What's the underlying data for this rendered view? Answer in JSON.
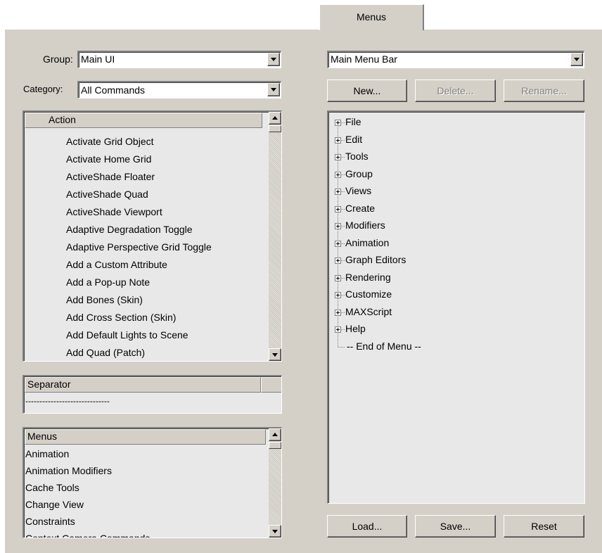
{
  "tab": {
    "label": "Menus"
  },
  "left": {
    "group": {
      "label": "Group:",
      "value": "Main UI"
    },
    "category": {
      "label": "Category:",
      "value": "All Commands"
    },
    "action_list": {
      "header": "Action",
      "items": [
        "Activate Grid Object",
        "Activate Home Grid",
        "ActiveShade Floater",
        "ActiveShade Quad",
        "ActiveShade Viewport",
        "Adaptive Degradation Toggle",
        "Adaptive Perspective Grid Toggle",
        "Add a Custom Attribute",
        "Add a Pop-up Note",
        "Add Bones (Skin)",
        "Add Cross Section (Skin)",
        "Add Default Lights to Scene",
        "Add Quad (Patch)"
      ]
    },
    "separator_list": {
      "header": "Separator",
      "items": [
        "------------------------------"
      ]
    },
    "menus_list": {
      "header": "Menus",
      "items": [
        "Animation",
        "Animation Modifiers",
        "Cache Tools",
        "Change View",
        "Constraints",
        "Context Camera Commands"
      ]
    }
  },
  "right": {
    "menu_select": {
      "value": "Main Menu Bar"
    },
    "buttons": {
      "new": "New...",
      "delete": "Delete...",
      "rename": "Rename..."
    },
    "tree": {
      "items": [
        "File",
        "Edit",
        "Tools",
        "Group",
        "Views",
        "Create",
        "Modifiers",
        "Animation",
        "Graph Editors",
        "Rendering",
        "Customize",
        "MAXScript",
        "Help"
      ],
      "end_label": "-- End of Menu --"
    },
    "bottom_buttons": {
      "load": "Load...",
      "save": "Save...",
      "reset": "Reset"
    }
  },
  "colors": {
    "face": "#d4d0c8",
    "list_bg": "#e8e8e8",
    "disabled_text": "#808080"
  }
}
